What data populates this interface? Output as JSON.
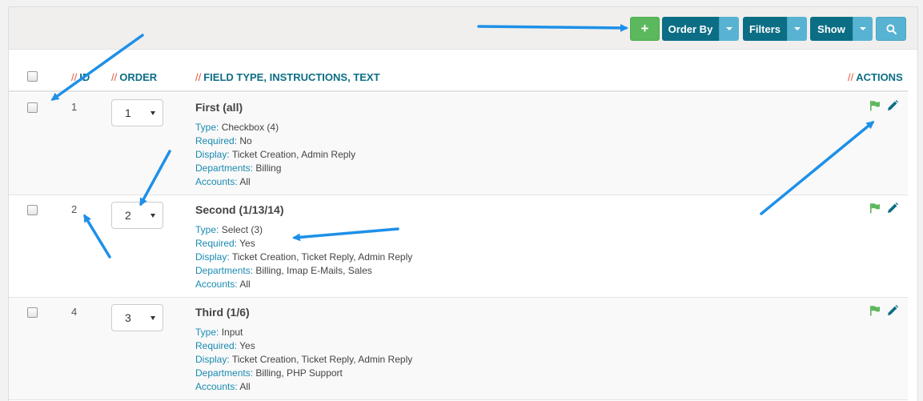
{
  "toolbar": {
    "add_label": "+",
    "order_by_label": "Order By",
    "filters_label": "Filters",
    "show_label": "Show"
  },
  "table": {
    "headers": {
      "slash": "//",
      "id": "ID",
      "order": "ORDER",
      "field": "FIELD TYPE, INSTRUCTIONS, TEXT",
      "actions": "ACTIONS"
    },
    "labels": {
      "type": "Type:",
      "required": "Required:",
      "display": "Display:",
      "departments": "Departments:",
      "accounts": "Accounts:"
    },
    "rows": [
      {
        "id": "1",
        "order": "1",
        "title": "First (all)",
        "type": "Checkbox (4)",
        "required": "No",
        "display": "Ticket Creation, Admin Reply",
        "departments": "Billing",
        "accounts": "All"
      },
      {
        "id": "2",
        "order": "2",
        "title": "Second (1/13/14)",
        "type": "Select (3)",
        "required": "Yes",
        "display": "Ticket Creation, Ticket Reply, Admin Reply",
        "departments": "Billing, Imap E-Mails, Sales",
        "accounts": "All"
      },
      {
        "id": "4",
        "order": "3",
        "title": "Third (1/6)",
        "type": "Input",
        "required": "Yes",
        "display": "Ticket Creation, Ticket Reply, Admin Reply",
        "departments": "Billing, PHP Support",
        "accounts": "All"
      }
    ]
  },
  "icons": {
    "add": "plus-icon",
    "search": "search-icon",
    "flag": "flag-icon",
    "edit": "pencil-icon",
    "dropdown": "caret-down-icon"
  },
  "colors": {
    "primary": "#0c6e85",
    "info": "#57b3d1",
    "success": "#5cb85c",
    "accent": "#e5533d",
    "link": "#1a8ab0",
    "annotation_arrow": "#1e90e8"
  }
}
